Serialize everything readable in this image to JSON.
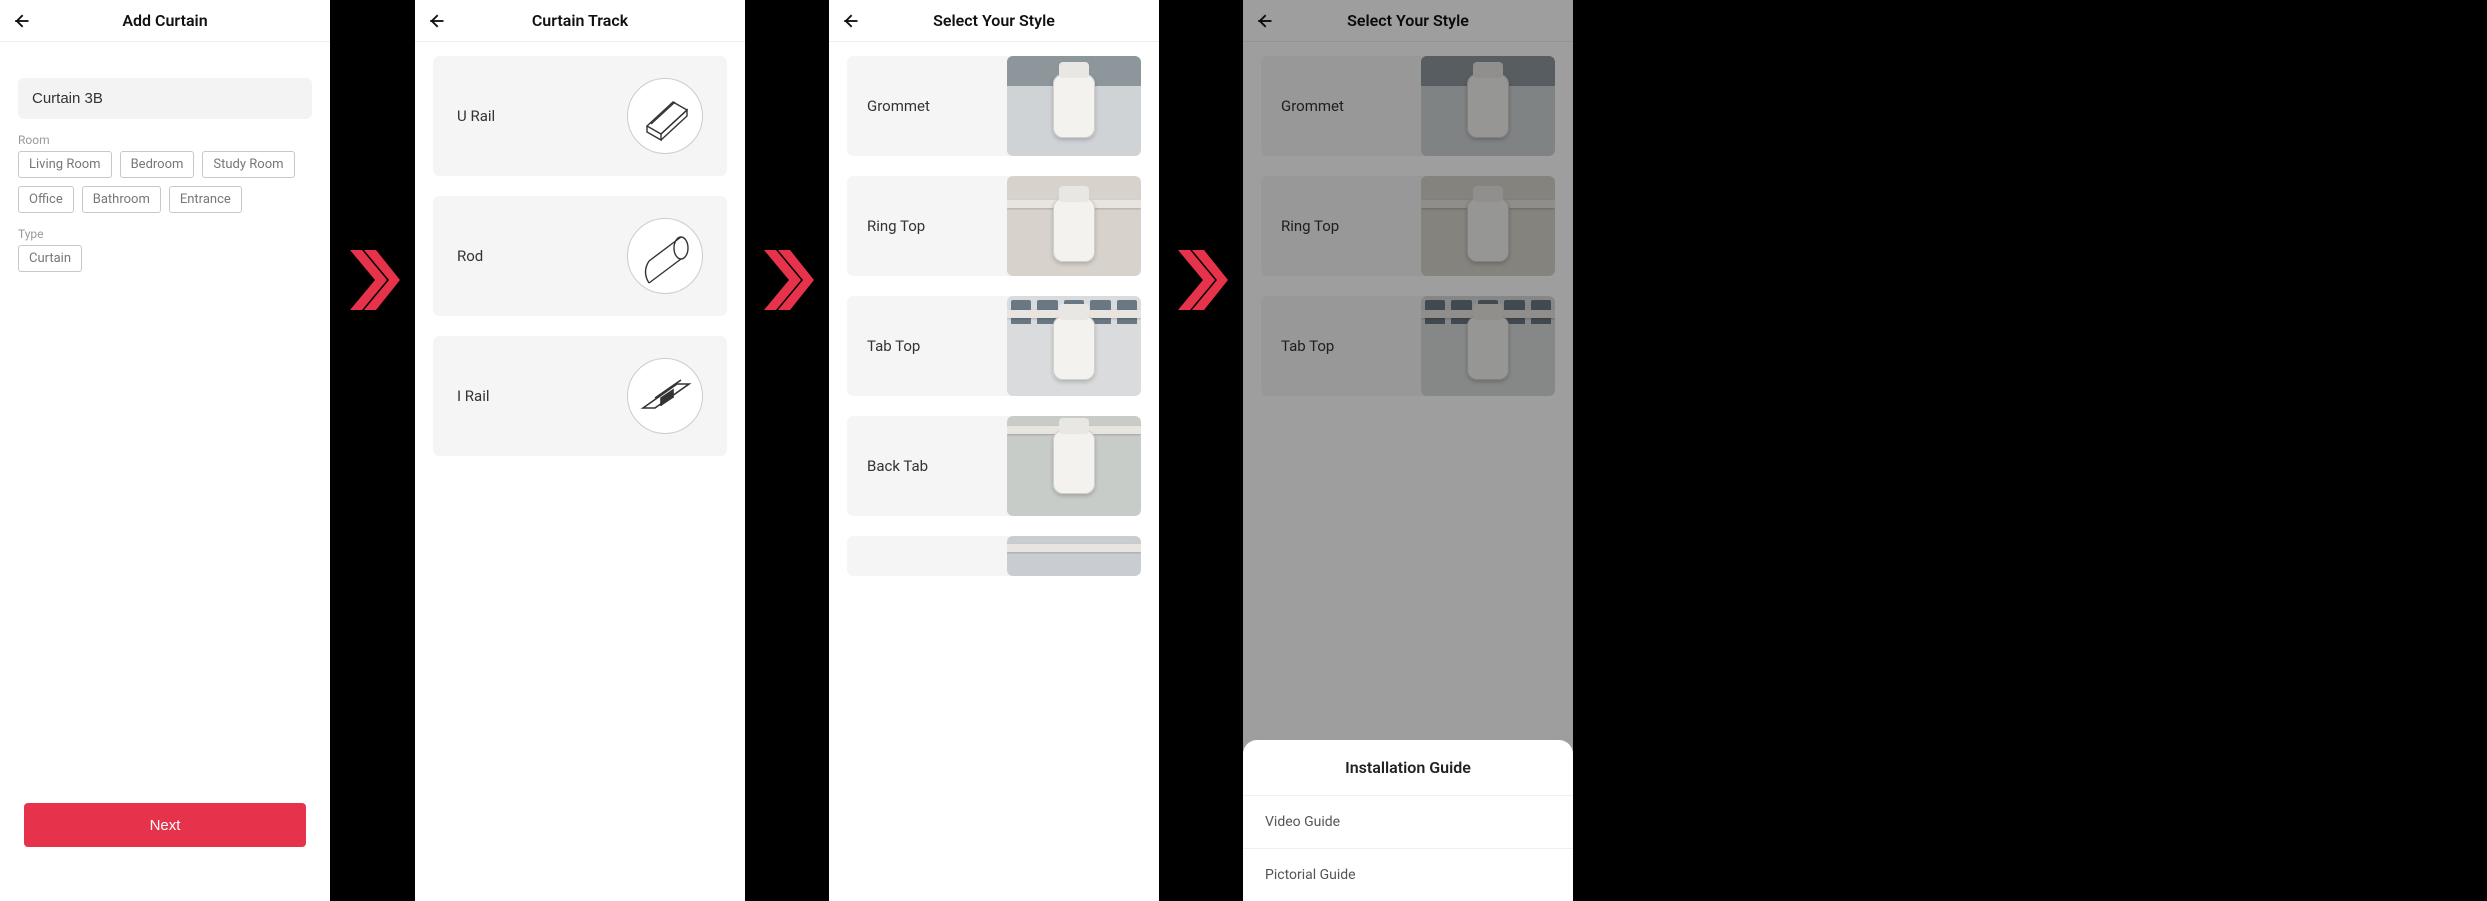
{
  "screen1": {
    "title": "Add Curtain",
    "name_value": "Curtain 3B",
    "room_label": "Room",
    "rooms": [
      "Living Room",
      "Bedroom",
      "Study Room",
      "Office",
      "Bathroom",
      "Entrance"
    ],
    "type_label": "Type",
    "types": [
      "Curtain"
    ],
    "next": "Next"
  },
  "screen2": {
    "title": "Curtain Track",
    "tracks": [
      {
        "label": "U Rail",
        "icon": "u-rail-icon"
      },
      {
        "label": "Rod",
        "icon": "rod-icon"
      },
      {
        "label": "I Rail",
        "icon": "i-rail-icon"
      }
    ]
  },
  "screen3": {
    "title": "Select Your Style",
    "styles": [
      {
        "label": "Grommet",
        "thumb": "grommet"
      },
      {
        "label": "Ring Top",
        "thumb": "ringtop"
      },
      {
        "label": "Tab Top",
        "thumb": "tabtop"
      },
      {
        "label": "Back Tab",
        "thumb": "backtab"
      }
    ]
  },
  "screen4": {
    "title": "Select Your Style",
    "styles": [
      {
        "label": "Grommet",
        "thumb": "grommet"
      },
      {
        "label": "Ring Top",
        "thumb": "ringtop"
      },
      {
        "label": "Tab Top",
        "thumb": "tabtop"
      }
    ],
    "sheet": {
      "title": "Installation Guide",
      "items": [
        "Video Guide",
        "Pictorial Guide"
      ]
    }
  }
}
